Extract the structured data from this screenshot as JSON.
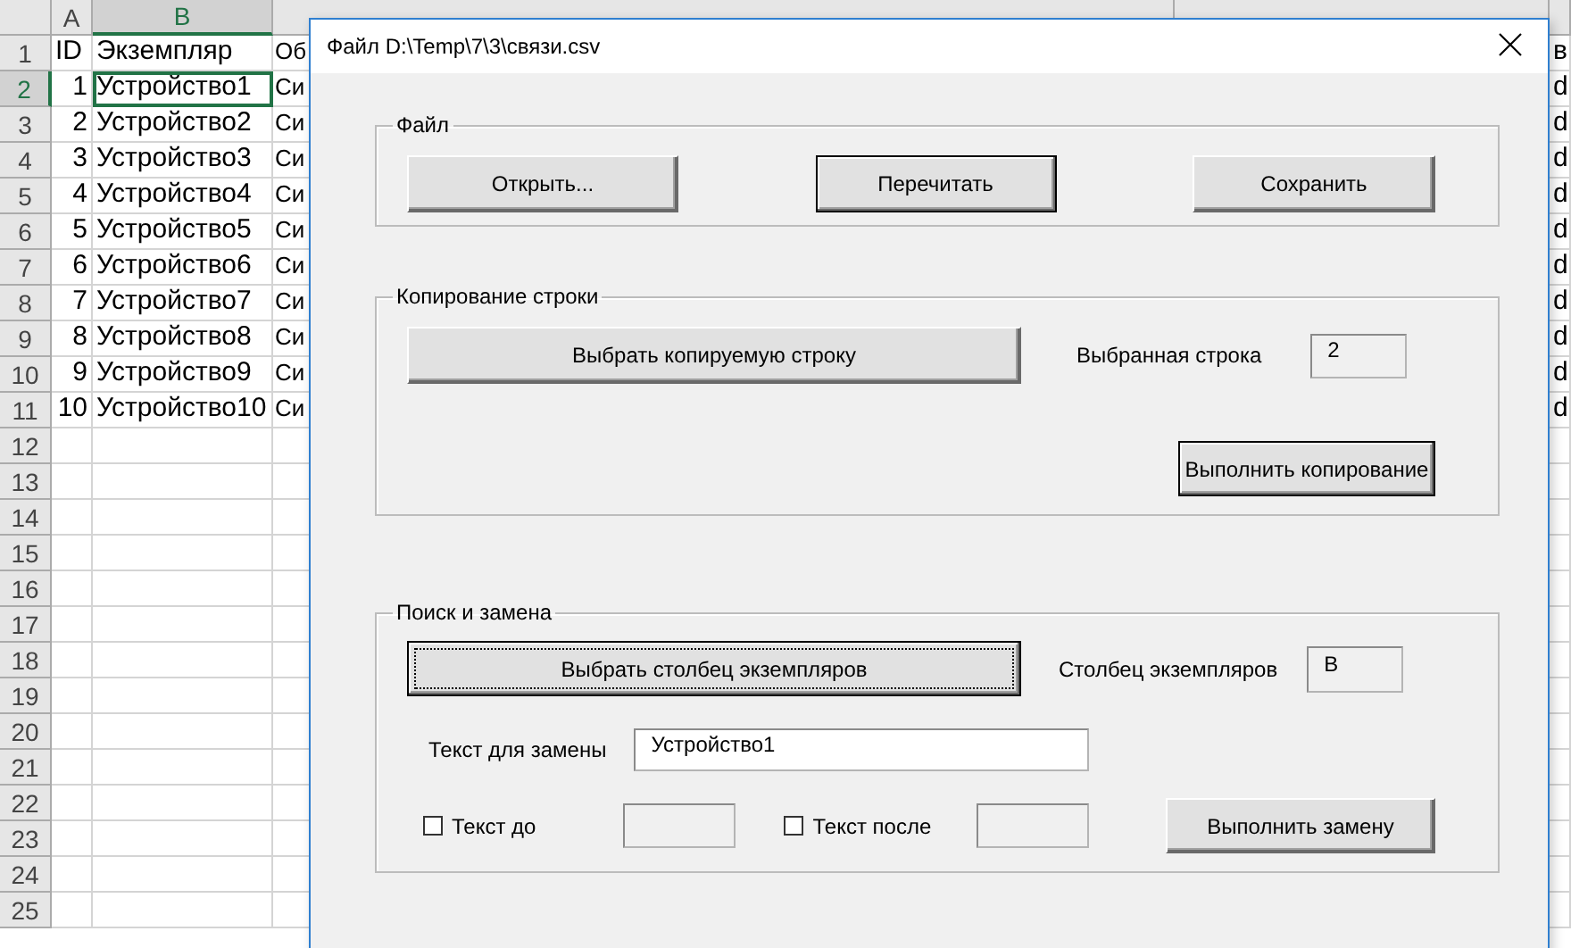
{
  "sheet": {
    "columns": [
      {
        "label": "A",
        "selected": false
      },
      {
        "label": "B",
        "selected": true
      }
    ],
    "row_numbers": [
      {
        "label": "1",
        "selected": false
      },
      {
        "label": "2",
        "selected": true
      },
      {
        "label": "3",
        "selected": false
      },
      {
        "label": "4",
        "selected": false
      },
      {
        "label": "5",
        "selected": false
      },
      {
        "label": "6",
        "selected": false
      },
      {
        "label": "7",
        "selected": false
      },
      {
        "label": "8",
        "selected": false
      },
      {
        "label": "9",
        "selected": false
      },
      {
        "label": "10",
        "selected": false
      },
      {
        "label": "11",
        "selected": false
      },
      {
        "label": "12",
        "selected": false
      },
      {
        "label": "13",
        "selected": false
      },
      {
        "label": "14",
        "selected": false
      },
      {
        "label": "15",
        "selected": false
      },
      {
        "label": "16",
        "selected": false
      },
      {
        "label": "17",
        "selected": false
      },
      {
        "label": "18",
        "selected": false
      },
      {
        "label": "19",
        "selected": false
      },
      {
        "label": "20",
        "selected": false
      },
      {
        "label": "21",
        "selected": false
      },
      {
        "label": "22",
        "selected": false
      },
      {
        "label": "23",
        "selected": false
      },
      {
        "label": "24",
        "selected": false
      },
      {
        "label": "25",
        "selected": false
      }
    ],
    "rows": [
      {
        "cells": [
          {
            "text": "ID",
            "selected": false
          },
          {
            "text": "Экземпляр",
            "selected": false
          },
          {
            "text": "Об",
            "selected": false
          },
          {
            "text": "в",
            "selected": false
          }
        ]
      },
      {
        "cells": [
          {
            "text": "1",
            "selected": false
          },
          {
            "text": "Устройство1",
            "selected": true
          },
          {
            "text": "Си",
            "selected": false
          },
          {
            "text": "d",
            "selected": false
          }
        ]
      },
      {
        "cells": [
          {
            "text": "2",
            "selected": false
          },
          {
            "text": "Устройство2",
            "selected": false
          },
          {
            "text": "Си",
            "selected": false
          },
          {
            "text": "d",
            "selected": false
          }
        ]
      },
      {
        "cells": [
          {
            "text": "3",
            "selected": false
          },
          {
            "text": "Устройство3",
            "selected": false
          },
          {
            "text": "Си",
            "selected": false
          },
          {
            "text": "d",
            "selected": false
          }
        ]
      },
      {
        "cells": [
          {
            "text": "4",
            "selected": false
          },
          {
            "text": "Устройство4",
            "selected": false
          },
          {
            "text": "Си",
            "selected": false
          },
          {
            "text": "d",
            "selected": false
          }
        ]
      },
      {
        "cells": [
          {
            "text": "5",
            "selected": false
          },
          {
            "text": "Устройство5",
            "selected": false
          },
          {
            "text": "Си",
            "selected": false
          },
          {
            "text": "d",
            "selected": false
          }
        ]
      },
      {
        "cells": [
          {
            "text": "6",
            "selected": false
          },
          {
            "text": "Устройство6",
            "selected": false
          },
          {
            "text": "Си",
            "selected": false
          },
          {
            "text": "d",
            "selected": false
          }
        ]
      },
      {
        "cells": [
          {
            "text": "7",
            "selected": false
          },
          {
            "text": "Устройство7",
            "selected": false
          },
          {
            "text": "Си",
            "selected": false
          },
          {
            "text": "d",
            "selected": false
          }
        ]
      },
      {
        "cells": [
          {
            "text": "8",
            "selected": false
          },
          {
            "text": "Устройство8",
            "selected": false
          },
          {
            "text": "Си",
            "selected": false
          },
          {
            "text": "d",
            "selected": false
          }
        ]
      },
      {
        "cells": [
          {
            "text": "9",
            "selected": false
          },
          {
            "text": "Устройство9",
            "selected": false
          },
          {
            "text": "Си",
            "selected": false
          },
          {
            "text": "d",
            "selected": false
          }
        ]
      },
      {
        "cells": [
          {
            "text": "10",
            "selected": false
          },
          {
            "text": "Устройство10",
            "selected": false
          },
          {
            "text": "Си",
            "selected": false
          },
          {
            "text": "d",
            "selected": false
          }
        ]
      }
    ]
  },
  "dialog": {
    "title": "Файл D:\\Temp\\7\\3\\связи.csv",
    "file_group": {
      "title": "Файл",
      "buttons": [
        {
          "label": "Открыть...",
          "default": false,
          "focused": false
        },
        {
          "label": "Перечитать",
          "default": true,
          "focused": false
        },
        {
          "label": "Сохранить",
          "default": false,
          "focused": false
        }
      ]
    },
    "copy_group": {
      "title": "Копирование строки",
      "pick_button": {
        "label": "Выбрать копируемую строку",
        "default": false,
        "focused": false
      },
      "selected_label": "Выбранная строка",
      "selected_field": {
        "value": "2",
        "locked": true
      },
      "run_button": {
        "label": "Выполнить копирование",
        "default": true,
        "focused": false
      }
    },
    "replace_group": {
      "title": "Поиск и замена",
      "pick_button": {
        "label": "Выбрать столбец экземпляров",
        "default": true,
        "focused": true
      },
      "column_label": "Столбец экземпляров",
      "column_field": {
        "value": "B",
        "locked": true
      },
      "replace_label": "Текст для замены",
      "replace_field": {
        "value": "Устройство1",
        "locked": false
      },
      "before": {
        "label": "Текст до",
        "checked": false,
        "field": {
          "locked": true
        }
      },
      "after": {
        "label": "Текст после",
        "checked": false,
        "field": {
          "locked": true
        }
      },
      "run_button": {
        "label": "Выполнить замену",
        "default": false,
        "focused": false
      }
    }
  }
}
